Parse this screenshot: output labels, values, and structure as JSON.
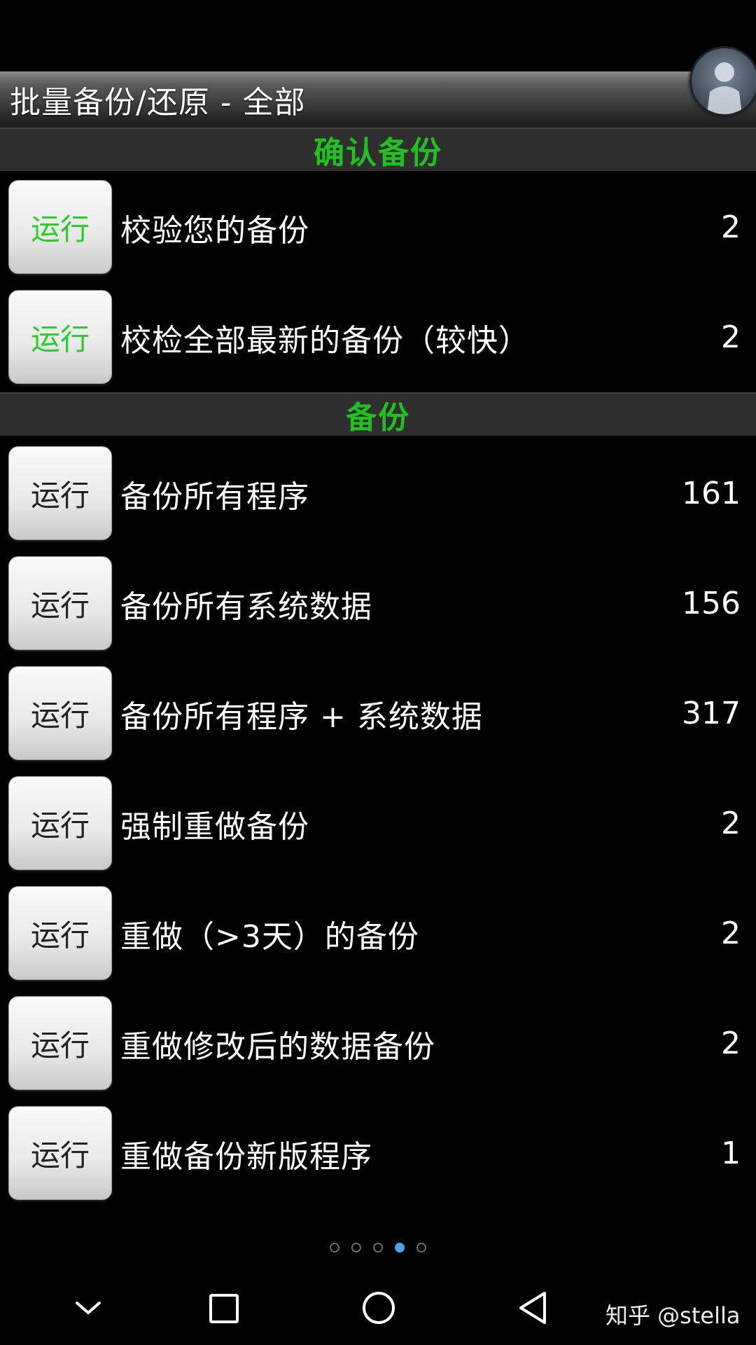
{
  "title_bar": {
    "title": "批量备份/还原 - 全部"
  },
  "sections": [
    {
      "header": "确认备份",
      "rows": [
        {
          "button": "运行",
          "label": "校验您的备份",
          "count": "2"
        },
        {
          "button": "运行",
          "label": "校检全部最新的备份（较快）",
          "count": "2"
        }
      ]
    },
    {
      "header": "备份",
      "rows": [
        {
          "button": "运行",
          "label": "备份所有程序",
          "count": "161"
        },
        {
          "button": "运行",
          "label": "备份所有系统数据",
          "count": "156"
        },
        {
          "button": "运行",
          "label": "备份所有程序 + 系统数据",
          "count": "317"
        },
        {
          "button": "运行",
          "label": "强制重做备份",
          "count": "2"
        },
        {
          "button": "运行",
          "label": "重做（>3天）的备份",
          "count": "2"
        },
        {
          "button": "运行",
          "label": "重做修改后的数据备份",
          "count": "2"
        },
        {
          "button": "运行",
          "label": "重做备份新版程序",
          "count": "1"
        }
      ]
    }
  ],
  "page_indicator": {
    "total": 5,
    "active_index": 3
  },
  "nav_bar": {
    "icons": [
      "chevron-down-icon",
      "recent-apps-square-icon",
      "home-circle-icon",
      "back-triangle-icon"
    ]
  },
  "watermark": "知乎 @stella",
  "colors": {
    "section_header_text": "#22c022",
    "confirm_button_text": "#2ecb2e",
    "active_dot": "#4aa3f0"
  }
}
